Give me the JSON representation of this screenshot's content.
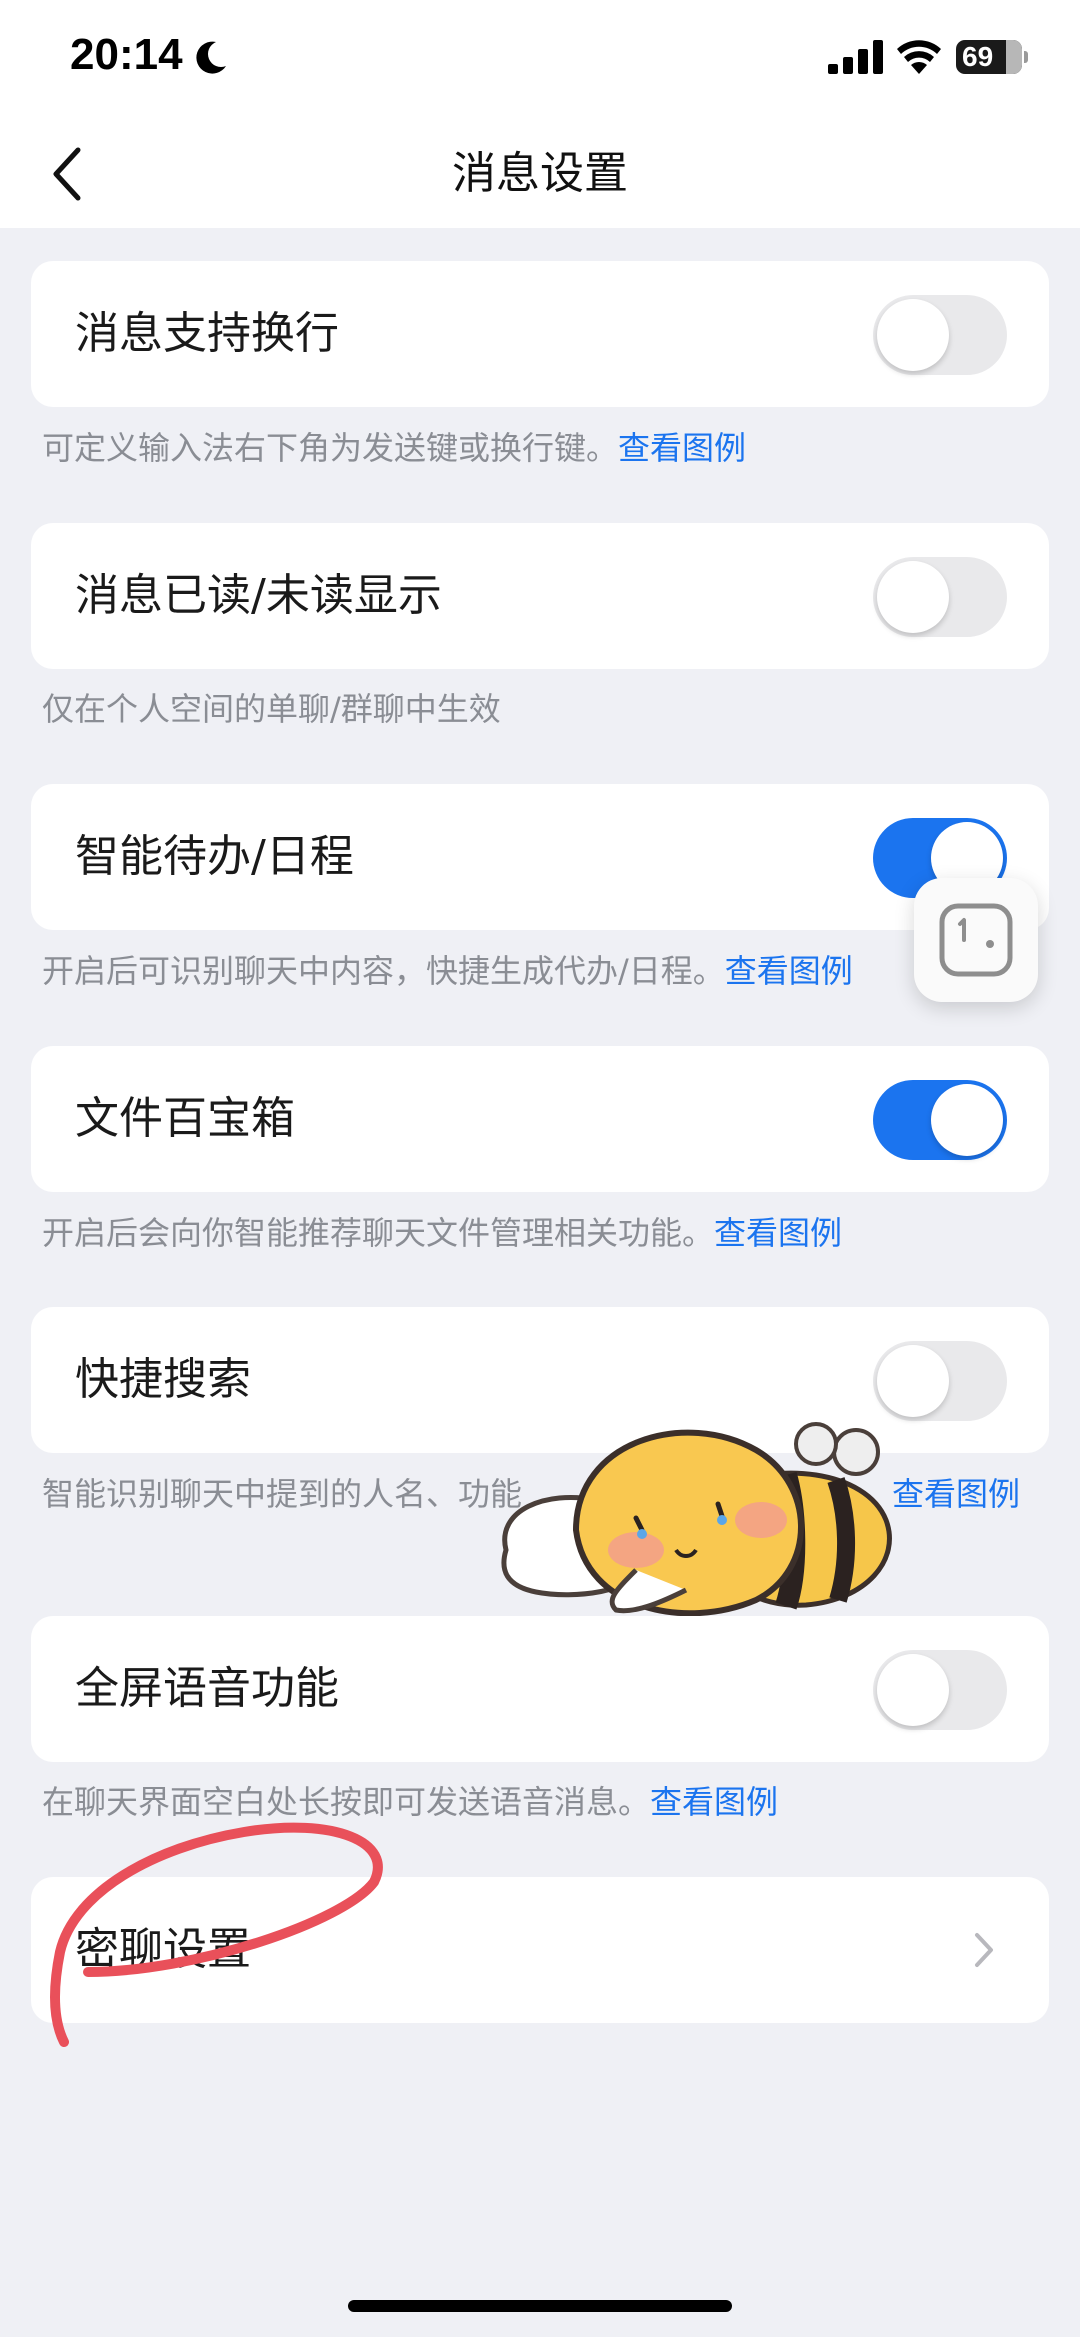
{
  "status_bar": {
    "time": "20:14",
    "battery_level": "69"
  },
  "nav": {
    "title": "消息设置"
  },
  "settings": [
    {
      "label": "消息支持换行",
      "enabled": false,
      "hint": "可定义输入法右下角为发送键或换行键。",
      "hint_link": "查看图例"
    },
    {
      "label": "消息已读/未读显示",
      "enabled": false,
      "hint": "仅在个人空间的单聊/群聊中生效",
      "hint_link": ""
    },
    {
      "label": "智能待办/日程",
      "enabled": true,
      "hint": "开启后可识别聊天中内容，快捷生成代办/日程。",
      "hint_link": "查看图例"
    },
    {
      "label": "文件百宝箱",
      "enabled": true,
      "hint": "开启后会向你智能推荐聊天文件管理相关功能。",
      "hint_link": "查看图例"
    },
    {
      "label": "快捷搜索",
      "enabled": false,
      "hint": "智能识别聊天中提到的人名、功能",
      "hint_link": "查看图例"
    },
    {
      "label": "全屏语音功能",
      "enabled": false,
      "hint": "在聊天界面空白处长按即可发送语音消息。",
      "hint_link": "查看图例"
    }
  ],
  "secret_chat": {
    "label": "密聊设置"
  },
  "colors": {
    "accent": "#1b74ef",
    "page_background": "#eff0f5",
    "hint_text": "#8a8d94",
    "annotation": "#e9505a"
  }
}
